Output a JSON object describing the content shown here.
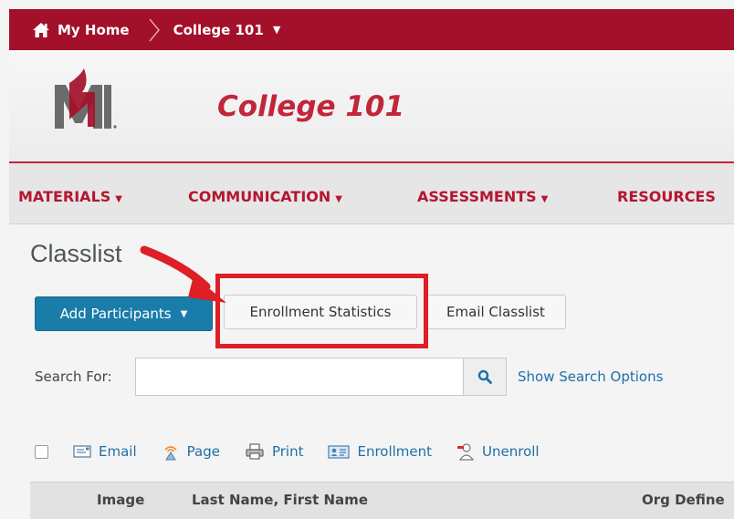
{
  "breadcrumb": {
    "home_label": "My Home",
    "course_label": "College 101"
  },
  "banner": {
    "logo_text": "M",
    "course_title": "College 101"
  },
  "nav": {
    "items": [
      "MATERIALS",
      "COMMUNICATION",
      "ASSESSMENTS",
      "RESOURCES"
    ]
  },
  "page": {
    "title": "Classlist"
  },
  "buttons": {
    "add_participants": "Add Participants",
    "enrollment_statistics": "Enrollment Statistics",
    "email_classlist": "Email Classlist"
  },
  "search": {
    "label": "Search For:",
    "value": "",
    "placeholder": "",
    "options_link": "Show Search Options"
  },
  "actions": {
    "email": "Email",
    "page": "Page",
    "print": "Print",
    "enrollment": "Enrollment",
    "unenroll": "Unenroll"
  },
  "table": {
    "columns": [
      "Image",
      "Last Name, First Name",
      "Org Define"
    ]
  },
  "colors": {
    "brand_red": "#a3102a",
    "title_red": "#c3253a",
    "primary_blue": "#1a7ca8",
    "link_blue": "#1e6fa5",
    "highlight_red": "#de1f26"
  }
}
